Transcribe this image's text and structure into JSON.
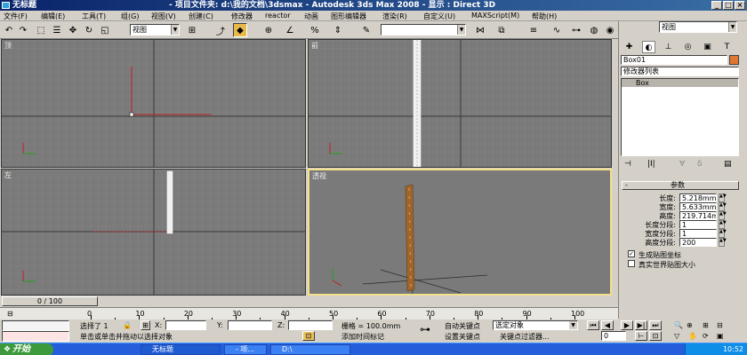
{
  "window": {
    "title": "无标题",
    "title_center": "- 项目文件夹: d:\\我的文档\\3dsmax    - Autodesk 3ds Max 2008    - 显示 : Direct 3D",
    "min": "_",
    "max": "□",
    "close": "×"
  },
  "menu": {
    "items": [
      "文件(F)",
      "编辑(E)",
      "工具(T)",
      "组(G)",
      "视图(V)",
      "创建(C)",
      "修改器",
      "reactor",
      "动画",
      "图形编辑器",
      "渲染(R)",
      "自定义(U)",
      "MAXScript(M)",
      "帮助(H)"
    ]
  },
  "toolbar": {
    "ref_coord": "视图",
    "named_sel": "",
    "right_combo": "视图"
  },
  "viewports": {
    "top": "顶",
    "front": "前",
    "left": "左",
    "persp": "透视"
  },
  "command_panel": {
    "object_name": "Box01",
    "object_color": "#e07830",
    "modifier_list": "修改器列表",
    "stack_item": "Box",
    "rollout_title": "参数",
    "params": [
      {
        "label": "长度:",
        "value": "5.218mm"
      },
      {
        "label": "宽度:",
        "value": "5.633mm"
      },
      {
        "label": "高度:",
        "value": "219.714m"
      },
      {
        "label": "长度分段:",
        "value": "1"
      },
      {
        "label": "宽度分段:",
        "value": "1"
      },
      {
        "label": "高度分段:",
        "value": "200"
      }
    ],
    "gen_mapping": "生成贴图坐标",
    "gen_mapping_checked": "✓",
    "real_world": "真实世界贴图大小"
  },
  "timeline": {
    "slider": "0 / 100",
    "ticks": [
      "0",
      "10",
      "20",
      "30",
      "40",
      "50",
      "60",
      "70",
      "80",
      "90",
      "100"
    ]
  },
  "status": {
    "selected": "选择了 1",
    "x_label": "X:",
    "y_label": "Y:",
    "z_label": "Z:",
    "x": "",
    "y": "",
    "z": "",
    "grid": "栅格 = 100.0mm",
    "auto_key": "自动关键点",
    "set_key": "设置关键点",
    "sel_obj": "选定对象",
    "key_filter": "关键点过滤器...",
    "prompt": "单击或单击并拖动以选择对象",
    "add_time_tag": "添加时间标记",
    "frame": "0"
  },
  "taskbar": {
    "start": "开始",
    "tasks": [
      "无标题",
      "- 项...",
      "D:\\"
    ],
    "clock": "10:52"
  },
  "icons": [
    "select-icon",
    "move-icon",
    "rotate-icon",
    "scale-icon",
    "snap-icon",
    "mirror-icon",
    "align-icon",
    "layer-icon",
    "curve-editor-icon",
    "schematic-icon",
    "material-icon",
    "render-icon",
    "create-tab-icon",
    "modify-tab-icon",
    "hierarchy-tab-icon",
    "motion-tab-icon",
    "display-tab-icon",
    "utilities-tab-icon",
    "key-icon",
    "play-icon",
    "zoom-icon",
    "pan-icon",
    "orbit-icon"
  ]
}
